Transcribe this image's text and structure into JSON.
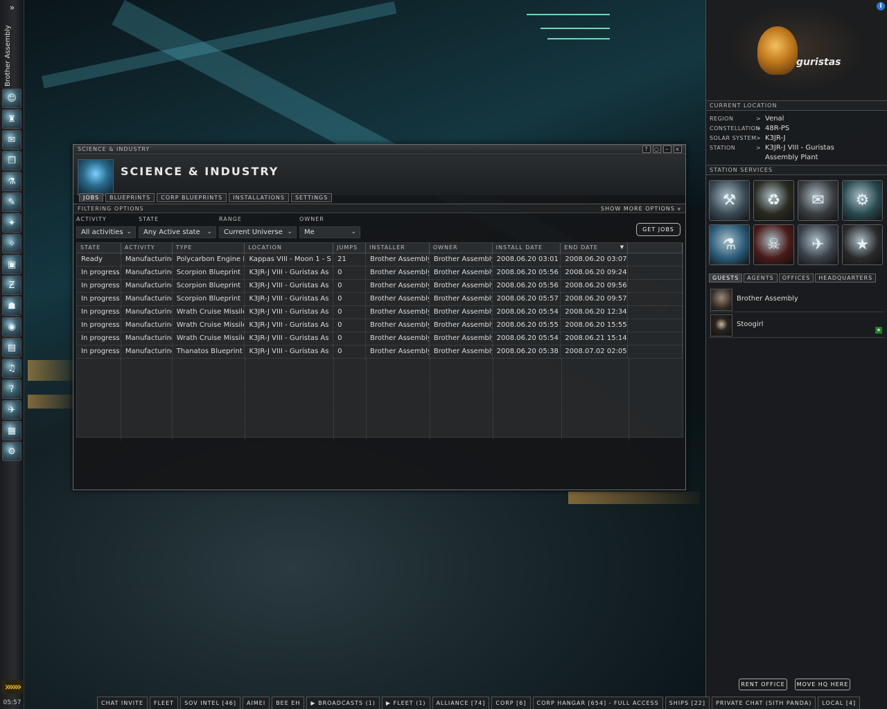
{
  "neocom": {
    "expand_glyph": "»",
    "pilot_name": "Brother Assembly",
    "clock": "05:57",
    "autopilot_glyph": "»»»",
    "buttons": [
      "portrait-icon",
      "character-sheet-icon",
      "mail-icon",
      "journal-icon",
      "science-industry-icon",
      "notepad-icon",
      "map-icon",
      "starmap-icon",
      "cargo-icon",
      "corporation-icon",
      "people-places-icon",
      "market-icon",
      "contracts-icon",
      "audio-icon",
      "help-icon",
      "ships-icon",
      "items-icon",
      "fitting-icon"
    ]
  },
  "window": {
    "caption": "Science & Industry",
    "title": "Science & Industry",
    "buttons": {
      "help": "?",
      "pin": "○",
      "minimize": "–",
      "close": "×"
    },
    "tabs": [
      "Jobs",
      "Blueprints",
      "Corp Blueprints",
      "Installations",
      "Settings"
    ],
    "filter_label": "Filtering Options",
    "more_options": "Show More Options",
    "filters": {
      "activity": {
        "label": "Activity",
        "value": "All activities"
      },
      "state": {
        "label": "State",
        "value": "Any Active state"
      },
      "range": {
        "label": "Range",
        "value": "Current Universe"
      },
      "owner": {
        "label": "Owner",
        "value": "Me"
      }
    },
    "get_jobs": "Get Jobs",
    "columns": [
      "State",
      "Activity",
      "Type",
      "Location",
      "Jumps",
      "Installer",
      "Owner",
      "Install Date",
      "End Date"
    ],
    "rows": [
      [
        "Ready",
        "Manufacturing",
        "Polycarbon Engine H",
        "Kappas VIII - Moon 1 - S",
        "21",
        "Brother Assembly",
        "Brother Assembly",
        "2008.06.20 03:01",
        "2008.06.20 03:07"
      ],
      [
        "In progress",
        "Manufacturing",
        "Scorpion Blueprint",
        "K3JR-J VIII - Guristas As",
        "0",
        "Brother Assembly",
        "Brother Assembly",
        "2008.06.20 05:56",
        "2008.06.20 09:24"
      ],
      [
        "In progress",
        "Manufacturing",
        "Scorpion Blueprint",
        "K3JR-J VIII - Guristas As",
        "0",
        "Brother Assembly",
        "Brother Assembly",
        "2008.06.20 05:56",
        "2008.06.20 09:56"
      ],
      [
        "In progress",
        "Manufacturing",
        "Scorpion Blueprint",
        "K3JR-J VIII - Guristas As",
        "0",
        "Brother Assembly",
        "Brother Assembly",
        "2008.06.20 05:57",
        "2008.06.20 09:57"
      ],
      [
        "In progress",
        "Manufacturing",
        "Wrath Cruise Missile",
        "K3JR-J VIII - Guristas As",
        "0",
        "Brother Assembly",
        "Brother Assembly",
        "2008.06.20 05:54",
        "2008.06.20 12:34"
      ],
      [
        "In progress",
        "Manufacturing",
        "Wrath Cruise Missile",
        "K3JR-J VIII - Guristas As",
        "0",
        "Brother Assembly",
        "Brother Assembly",
        "2008.06.20 05:55",
        "2008.06.20 15:55"
      ],
      [
        "In progress",
        "Manufacturing",
        "Wrath Cruise Missile",
        "K3JR-J VIII - Guristas As",
        "0",
        "Brother Assembly",
        "Brother Assembly",
        "2008.06.20 05:54",
        "2008.06.21 15:14"
      ],
      [
        "In progress",
        "Manufacturing",
        "Thanatos Blueprint",
        "K3JR-J VIII - Guristas As",
        "0",
        "Brother Assembly",
        "Brother Assembly",
        "2008.06.20 05:38",
        "2008.07.02 02:05"
      ]
    ]
  },
  "station": {
    "corp_name": "guristas",
    "info_glyph": "i",
    "current_location_title": "Current Location",
    "location": [
      {
        "label": "Region",
        "value": "Venal"
      },
      {
        "label": "Constellation",
        "value": "48R-PS"
      },
      {
        "label": "Solar System",
        "value": "K3JR-J"
      },
      {
        "label": "Station",
        "value": "K3JR-J VIII - Guristas"
      }
    ],
    "station_line2": "Assembly Plant",
    "arrow": ">",
    "services_title": "Station Services",
    "services": [
      "repair-shop-icon",
      "reprocessing-icon",
      "market-icon",
      "fitting-icon",
      "science-industry-icon",
      "bounty-office-icon",
      "clone-bay-icon",
      "medal-icon"
    ],
    "tabs": [
      "Guests",
      "Agents",
      "Offices",
      "Headquarters"
    ],
    "guests": [
      "Brother Assembly",
      "Stoogirl"
    ],
    "rent_office": "Rent Office",
    "move_hq": "Move HQ Here"
  },
  "chat_tabs": [
    "Chat Invite",
    "Fleet",
    "Sov Intel [46]",
    "Aimei",
    "Bee eh",
    "▶ Broadcasts (1)",
    "▶ Fleet (1)",
    "Alliance [74]",
    "Corp [6]",
    "Corp Hangar [654] - Full Access",
    "Ships [22]",
    "Private Chat (Sith Panda)",
    "Local [4]"
  ]
}
